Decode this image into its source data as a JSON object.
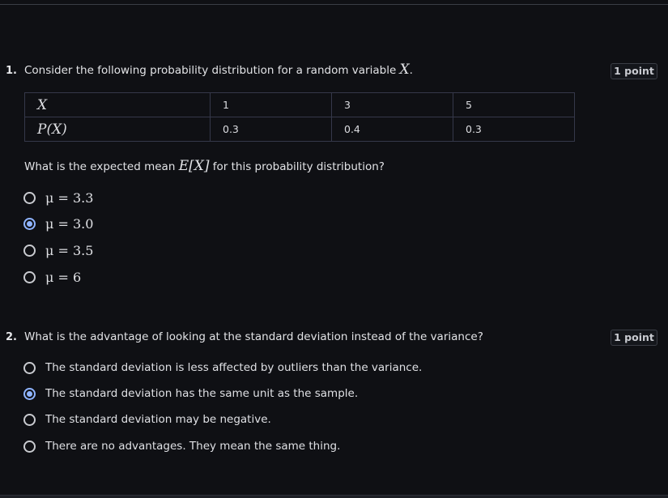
{
  "questions": [
    {
      "number": "1.",
      "prompt_prefix": "Consider the following probability distribution for a random variable",
      "prompt_math": "X",
      "prompt_suffix": ".",
      "points": "1 point",
      "table": {
        "row_header_x": "X",
        "row_header_p": "P(X)",
        "x_values": [
          "1",
          "3",
          "5"
        ],
        "p_values": [
          "0.3",
          "0.4",
          "0.3"
        ]
      },
      "subprompt_prefix": "What is the expected mean",
      "subprompt_math": "E[X]",
      "subprompt_suffix": "for this probability distribution?",
      "options": [
        {
          "label": "μ = 3.3",
          "selected": false
        },
        {
          "label": "μ = 3.0",
          "selected": true
        },
        {
          "label": "μ = 3.5",
          "selected": false
        },
        {
          "label": "μ = 6",
          "selected": false
        }
      ]
    },
    {
      "number": "2.",
      "prompt": "What is the advantage of looking at the standard deviation instead of the variance?",
      "points": "1 point",
      "options": [
        {
          "label": "The standard deviation is less affected by outliers than the variance.",
          "selected": false
        },
        {
          "label": "The standard deviation has the same unit as the sample.",
          "selected": true
        },
        {
          "label": "The standard deviation may be negative.",
          "selected": false
        },
        {
          "label": "There are no advantages. They mean the same thing.",
          "selected": false
        }
      ]
    }
  ],
  "colors": {
    "background": "#0f1014",
    "accent": "#8fb4ff",
    "text": "#e4e5e8",
    "border": "#35384a"
  }
}
